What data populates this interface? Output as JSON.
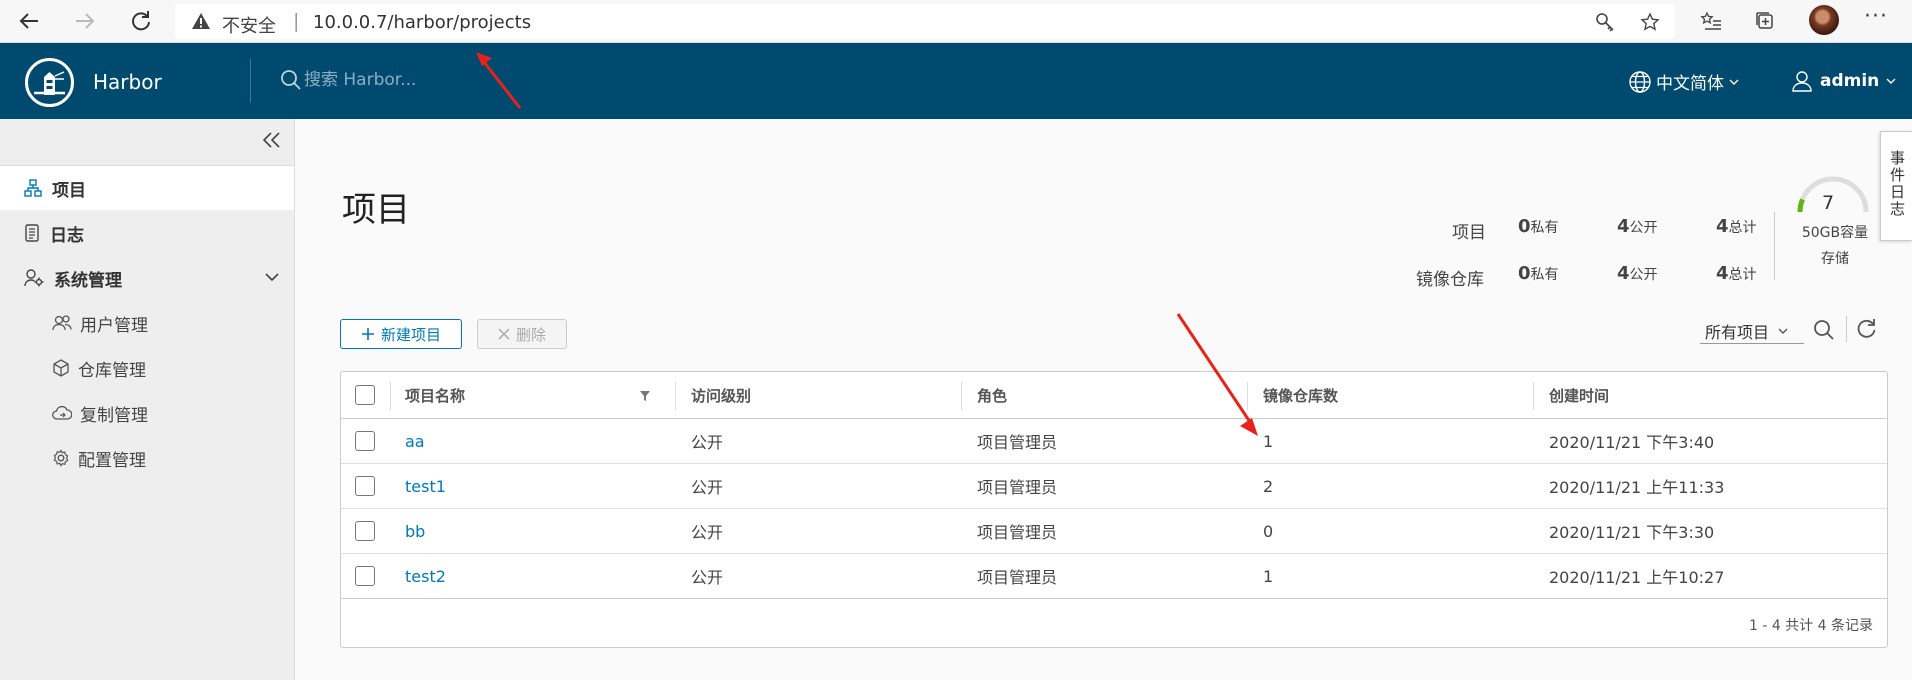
{
  "browser": {
    "insecure_label": "不安全",
    "url": "10.0.0.7/harbor/projects"
  },
  "header": {
    "brand": "Harbor",
    "search_placeholder": "搜索 Harbor...",
    "language": "中文简体",
    "user": "admin"
  },
  "sidebar": {
    "items": [
      {
        "label": "项目"
      },
      {
        "label": "日志"
      },
      {
        "label": "系统管理"
      }
    ],
    "sub_items": [
      {
        "label": "用户管理"
      },
      {
        "label": "仓库管理"
      },
      {
        "label": "复制管理"
      },
      {
        "label": "配置管理"
      }
    ]
  },
  "main": {
    "title": "项目",
    "summary": {
      "projects_label": "项目",
      "repos_label": "镜像仓库",
      "projects": {
        "private": "0",
        "public": "4",
        "total": "4"
      },
      "repos": {
        "private": "0",
        "public": "4",
        "total": "4"
      },
      "private_unit": "私有",
      "public_unit": "公开",
      "total_unit": "总计"
    },
    "storage": {
      "value": "7",
      "capacity": "50GB容量",
      "label": "存储"
    },
    "event_log_tab": "事件日志",
    "new_project_button": "新建项目",
    "delete_button": "删除",
    "filter_select": "所有项目",
    "table": {
      "headers": [
        "项目名称",
        "访问级别",
        "角色",
        "镜像仓库数",
        "创建时间"
      ],
      "rows": [
        {
          "name": "aa",
          "access": "公开",
          "role": "项目管理员",
          "repos": "1",
          "created": "2020/11/21 下午3:40"
        },
        {
          "name": "test1",
          "access": "公开",
          "role": "项目管理员",
          "repos": "2",
          "created": "2020/11/21 上午11:33"
        },
        {
          "name": "bb",
          "access": "公开",
          "role": "项目管理员",
          "repos": "0",
          "created": "2020/11/21 下午3:30"
        },
        {
          "name": "test2",
          "access": "公开",
          "role": "项目管理员",
          "repos": "1",
          "created": "2020/11/21 上午10:27"
        }
      ],
      "footer": "1 - 4 共计 4 条记录"
    }
  },
  "colors": {
    "header_bg": "#004a70",
    "accent": "#0079b8",
    "annotation_arrow": "#e8221a"
  }
}
